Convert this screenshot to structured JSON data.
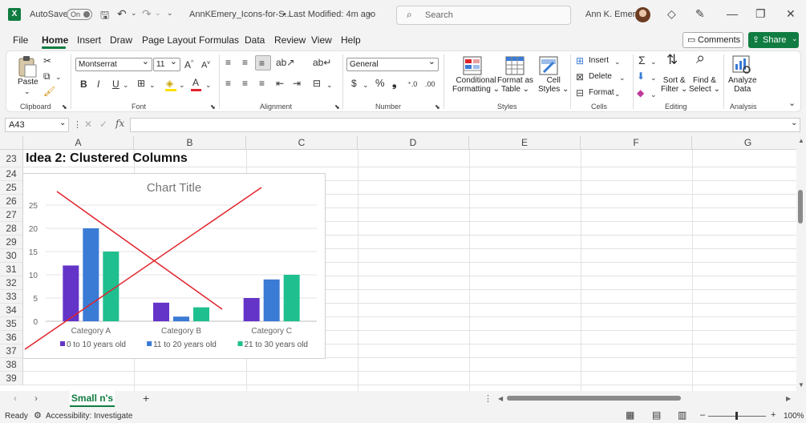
{
  "titlebar": {
    "autosave_label": "AutoSave",
    "autosave_state": "On",
    "filename": "AnnKEmery_Icons-for-S...",
    "modified": "• Last Modified: 4m ago",
    "search_placeholder": "Search",
    "user_name": "Ann K. Emery"
  },
  "menu": {
    "items": [
      "File",
      "Home",
      "Insert",
      "Draw",
      "Page Layout",
      "Formulas",
      "Data",
      "Review",
      "View",
      "Help"
    ],
    "comments_label": "Comments",
    "share_label": "Share"
  },
  "ribbon": {
    "clipboard": {
      "paste": "Paste",
      "label": "Clipboard"
    },
    "font": {
      "family": "Montserrat",
      "size": "11",
      "label": "Font"
    },
    "alignment": {
      "label": "Alignment"
    },
    "number": {
      "format": "General",
      "label": "Number"
    },
    "styles": {
      "conditional": [
        "Conditional",
        "Formatting ⌄"
      ],
      "format_table": [
        "Format as",
        "Table ⌄"
      ],
      "cell_styles": [
        "Cell",
        "Styles ⌄"
      ],
      "label": "Styles"
    },
    "cells": {
      "insert": "Insert",
      "delete": "Delete",
      "format": "Format",
      "label": "Cells"
    },
    "editing": {
      "sort": [
        "Sort &",
        "Filter ⌄"
      ],
      "find": [
        "Find &",
        "Select ⌄"
      ],
      "label": "Editing"
    },
    "analysis": {
      "analyze": [
        "Analyze",
        "Data"
      ],
      "label": "Analysis"
    }
  },
  "formula_bar": {
    "name_box": "A43",
    "formula": ""
  },
  "grid": {
    "columns": [
      "A",
      "B",
      "C",
      "D",
      "E",
      "F",
      "G"
    ],
    "rows": [
      "23",
      "24",
      "25",
      "26",
      "27",
      "28",
      "29",
      "30",
      "31",
      "32",
      "33",
      "34",
      "35",
      "36",
      "37",
      "38",
      "39"
    ],
    "a23": "Idea 2: Clustered Columns"
  },
  "chart_data": {
    "type": "bar",
    "title": "Chart Title",
    "categories": [
      "Category A",
      "Category B",
      "Category C"
    ],
    "series": [
      {
        "name": "0 to 10 years old",
        "values": [
          12,
          4,
          5
        ],
        "color": "#6434c8"
      },
      {
        "name": "11 to 20 years old",
        "values": [
          20,
          1,
          9
        ],
        "color": "#3a7bd5"
      },
      {
        "name": "21 to 30 years old",
        "values": [
          15,
          3,
          10
        ],
        "color": "#1fbf8f"
      }
    ],
    "ylim": [
      0,
      25
    ],
    "yticks": [
      "0",
      "5",
      "10",
      "15",
      "20",
      "25"
    ],
    "legend": "bottom",
    "crossed_out": true,
    "cross_color": "#e0242c"
  },
  "sheets": {
    "active": "Small n's"
  },
  "status": {
    "ready": "Ready",
    "accessibility": "Accessibility: Investigate",
    "zoom": "100%"
  }
}
